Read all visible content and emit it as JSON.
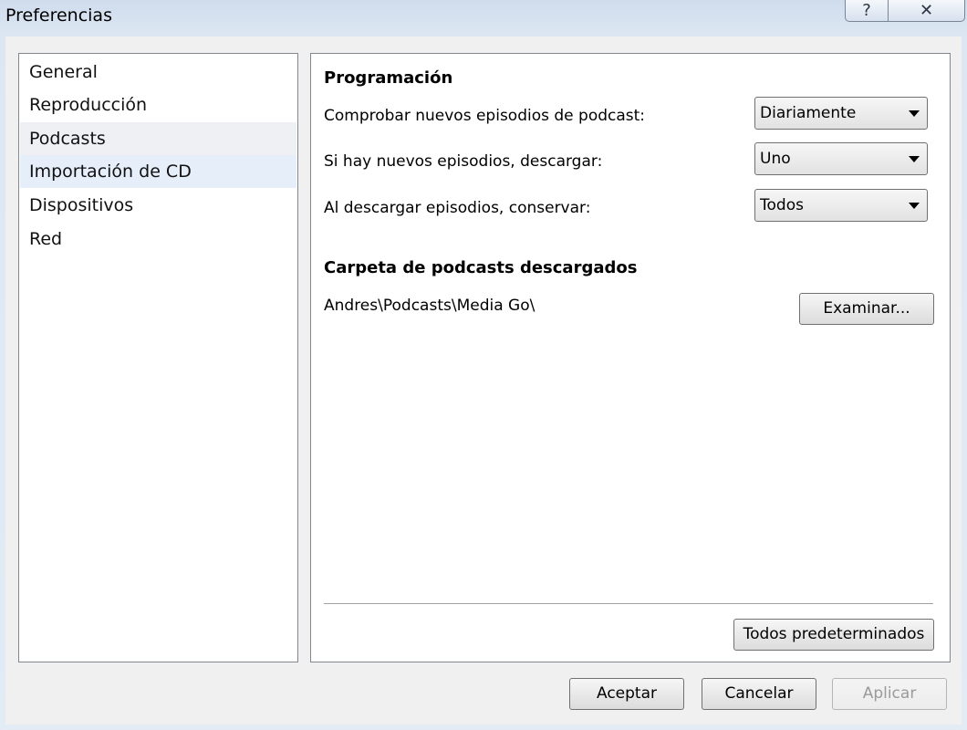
{
  "window": {
    "title": "Preferencias",
    "help_glyph": "?",
    "close_glyph": "✕"
  },
  "nav": {
    "items": [
      {
        "label": "General"
      },
      {
        "label": "Reproducción"
      },
      {
        "label": "Podcasts"
      },
      {
        "label": "Importación de CD"
      },
      {
        "label": "Dispositivos"
      },
      {
        "label": "Red"
      }
    ],
    "selected": "Importación de CD",
    "hovered": "Podcasts"
  },
  "schedule": {
    "title": "Programación",
    "rows": [
      {
        "label": "Comprobar nuevos episodios de podcast:",
        "value": "Diariamente"
      },
      {
        "label": "Si hay nuevos episodios, descargar:",
        "value": "Uno"
      },
      {
        "label": "Al descargar episodios, conservar:",
        "value": "Todos"
      }
    ]
  },
  "folder": {
    "title": "Carpeta de podcasts descargados",
    "path": "Andres\\Podcasts\\Media Go\\",
    "browse_label": "Examinar..."
  },
  "defaults_label": "Todos predeterminados",
  "footer": {
    "ok_label": "Aceptar",
    "cancel_label": "Cancelar",
    "apply_label": "Aplicar"
  }
}
